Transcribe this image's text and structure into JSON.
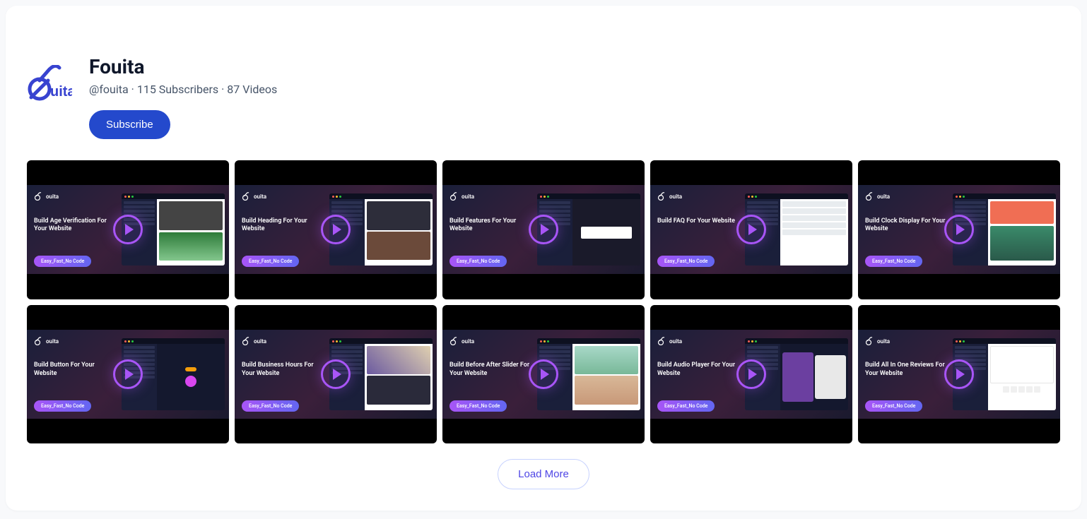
{
  "channel": {
    "name": "Fouita",
    "handle": "@fouita",
    "subscribers": "115 Subscribers",
    "video_count": "87 Videos",
    "logo_text": "uita"
  },
  "buttons": {
    "subscribe": "Subscribe",
    "load_more": "Load More"
  },
  "thumb": {
    "brand": "ouita",
    "badge": "Easy_Fast_No Code"
  },
  "videos": [
    {
      "title": "Build Age Verification For Your Website"
    },
    {
      "title": "Build Heading For Your Website"
    },
    {
      "title": "Build Features For Your Website"
    },
    {
      "title": "Build FAQ For Your Website"
    },
    {
      "title": "Build Clock Display For Your Website"
    },
    {
      "title": "Build Button For Your Website"
    },
    {
      "title": "Build Business Hours For Your Website"
    },
    {
      "title": "Build Before After Slider For Your Website"
    },
    {
      "title": "Build Audio Player For Your Website"
    },
    {
      "title": "Build All In One Reviews For Your Website"
    }
  ],
  "colors": {
    "accent": "#2449cc",
    "play": "#a855f7",
    "link": "#4f46e5"
  }
}
